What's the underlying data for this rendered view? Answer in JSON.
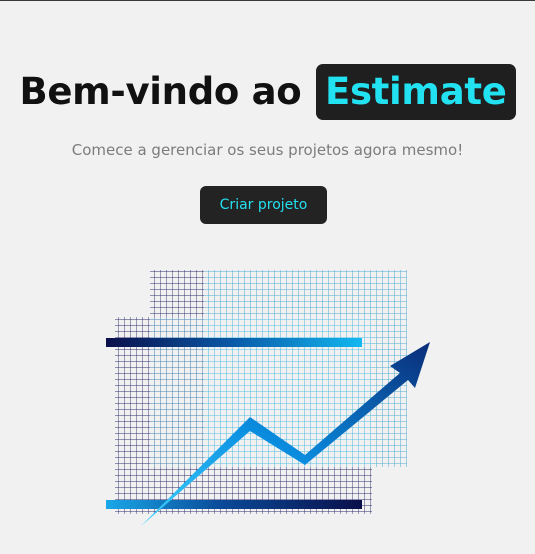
{
  "hero": {
    "title_prefix": "Bem-vindo ao",
    "brand": "Estimate",
    "subtitle": "Comece a gerenciar os seus projetos agora mesmo!",
    "cta_label": "Criar projeto"
  },
  "colors": {
    "background": "#f2f1f2",
    "accent": "#22e1f0",
    "button_bg": "#232323",
    "brand_bg": "#1f1f1f",
    "title_text": "#111111",
    "subtitle_text": "#7c7c7c"
  },
  "illustration": {
    "icon": "growth-chart-icon"
  }
}
